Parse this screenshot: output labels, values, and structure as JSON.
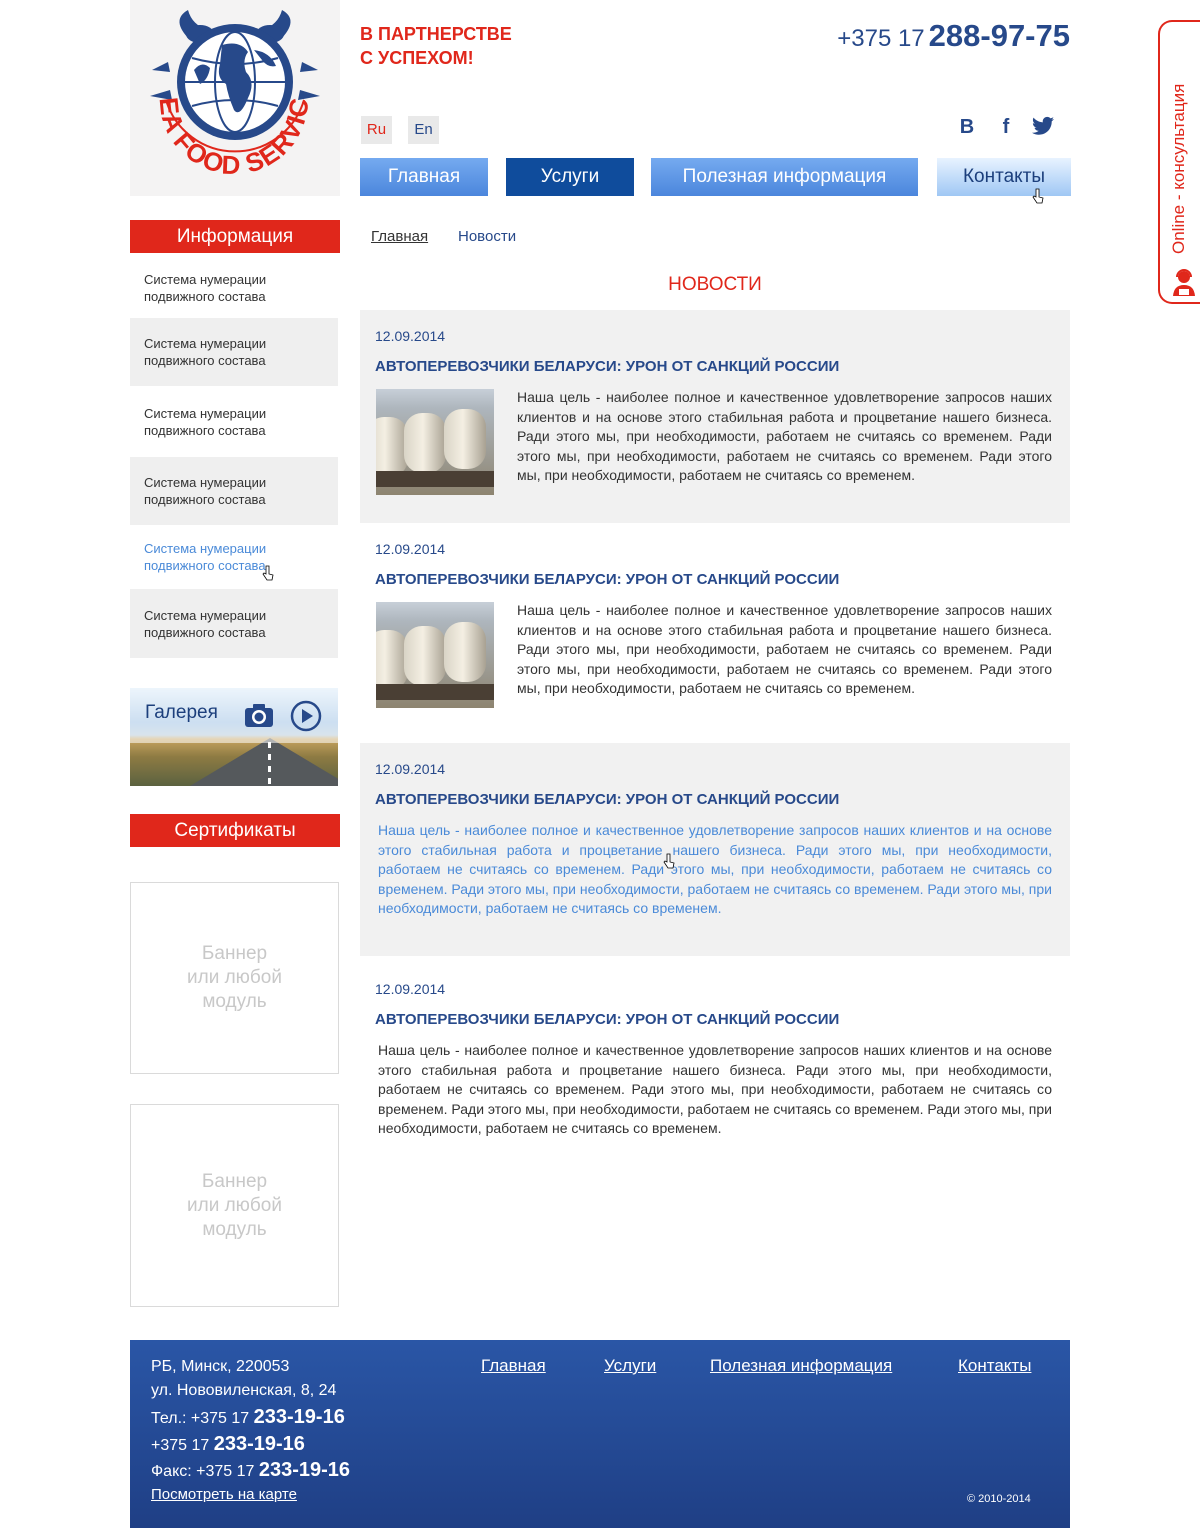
{
  "header": {
    "logo_text": "SEA FOOD SERVICE",
    "slogan_line1": "В ПАРТНЕРСТВЕ",
    "slogan_line2": "С УСПЕХОМ!",
    "phone_code": "+375 17",
    "phone_number": "288-97-75",
    "lang_ru": "Ru",
    "lang_en": "En",
    "social": {
      "vk": "B",
      "fb": "f"
    }
  },
  "nav": [
    {
      "label": "Главная"
    },
    {
      "label": "Услуги"
    },
    {
      "label": "Полезная информация"
    },
    {
      "label": "Контакты"
    }
  ],
  "sidebar": {
    "info_title": "Информация",
    "items": [
      {
        "line1": "Система нумерации",
        "line2": "подвижного состава"
      },
      {
        "line1": "Система нумерации",
        "line2": "подвижного состава"
      },
      {
        "line1": "Система нумерации",
        "line2": "подвижного состава"
      },
      {
        "line1": "Система нумерации",
        "line2": "подвижного состава"
      },
      {
        "line1": "Система нумерации",
        "line2": "подвижного состава"
      },
      {
        "line1": "Система нумерации",
        "line2": "подвижного состава"
      }
    ],
    "gallery_label": "Галерея",
    "cert_title": "Сертификаты",
    "banner_line1": "Баннер",
    "banner_line2": "или любой",
    "banner_line3": "модуль"
  },
  "breadcrumb": {
    "home": "Главная",
    "current": "Новости"
  },
  "page_title": "НОВОСТИ",
  "news": [
    {
      "date": "12.09.2014",
      "title": "АВТОПЕРЕВОЗЧИКИ БЕЛАРУСИ: УРОН ОТ САНКЦИЙ РОССИИ",
      "text": "Наша цель - наиболее полное и качественное удовлетворение запросов наших клиентов и на основе этого стабильная работа и процветание нашего бизнеса. Ради этого мы, при необходимости, работаем не считаясь со временем. Ради этого мы, при необходимости, работаем не считаясь со временем. Ради этого мы, при необходимости, работаем не считаясь со временем."
    },
    {
      "date": "12.09.2014",
      "title": "АВТОПЕРЕВОЗЧИКИ БЕЛАРУСИ: УРОН ОТ САНКЦИЙ РОССИИ",
      "text": "Наша цель - наиболее полное и качественное удовлетворение запросов наших клиентов и на основе этого стабильная работа и процветание нашего бизнеса. Ради этого мы, при необходимости, работаем не считаясь со временем. Ради этого мы, при необходимости, работаем не считаясь со временем. Ради этого мы, при необходимости, работаем не считаясь со временем."
    },
    {
      "date": "12.09.2014",
      "title": "АВТОПЕРЕВОЗЧИКИ БЕЛАРУСИ: УРОН ОТ САНКЦИЙ РОССИИ",
      "text": "Наша цель - наиболее полное и качественное удовлетворение запросов наших клиентов и на основе этого стабильная работа и процветание нашего бизнеса. Ради этого мы, при необходимости, работаем не считаясь со временем. Ради этого мы, при необходимости, работаем не считаясь со временем. Ради этого мы, при необходимости, работаем не считаясь со временем. Ради этого мы, при необходимости, работаем не считаясь со временем."
    },
    {
      "date": "12.09.2014",
      "title": "АВТОПЕРЕВОЗЧИКИ БЕЛАРУСИ: УРОН ОТ САНКЦИЙ РОССИИ",
      "text": "Наша цель - наиболее полное и качественное удовлетворение запросов наших клиентов и на основе этого стабильная работа и процветание нашего бизнеса. Ради этого мы, при необходимости, работаем не считаясь со временем. Ради этого мы, при необходимости, работаем не считаясь со временем. Ради этого мы, при необходимости, работаем не считаясь со временем. Ради этого мы, при необходимости, работаем не считаясь со временем."
    }
  ],
  "consult_label": "Online - консультация",
  "footer": {
    "address1": "РБ, Минск, 220053",
    "address2": "ул. Нововиленская, 8, 24",
    "tel_label": "Тел.: +375 17",
    "tel_num": "233-19-16",
    "tel2_label": "+375 17",
    "tel2_num": "233-19-16",
    "fax_label": "Факс: +375 17",
    "fax_num": "233-19-16",
    "map_link": "Посмотреть на карте",
    "links": [
      "Главная",
      "Услуги",
      "Полезная информация",
      "Контакты"
    ],
    "copyright": "© 2010-2014"
  },
  "colors": {
    "accent_red": "#e0271b",
    "brand_blue": "#27498a",
    "nav_active": "#0f4c9c",
    "link_hover": "#4a8ad8"
  },
  "icons": [
    "globe-crab-logo",
    "vk-icon",
    "facebook-icon",
    "twitter-icon",
    "camera-icon",
    "play-icon",
    "operator-icon",
    "hand-cursor-icon"
  ]
}
